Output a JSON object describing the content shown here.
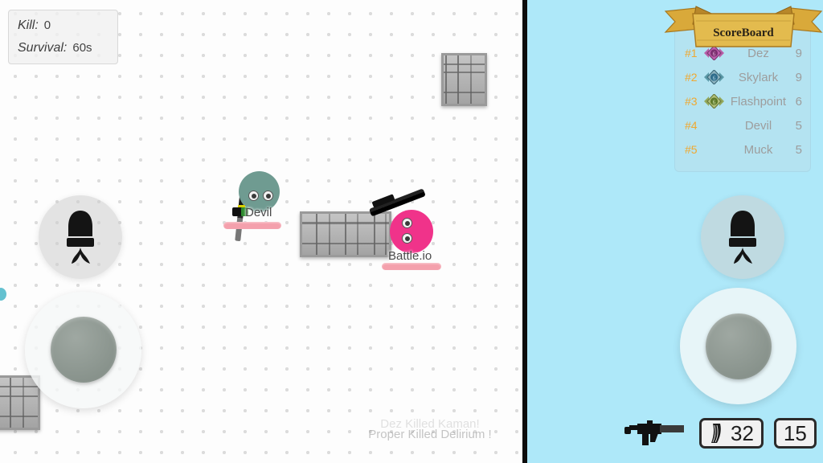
{
  "hud": {
    "stats": {
      "kill_label": "Kill:",
      "kill_value": "0",
      "survival_label": "Survival:",
      "survival_value": "60s"
    },
    "ammo": {
      "weapon_icon": "submachine-gun-icon",
      "magazine_icon": "magazine-icon",
      "clip": "32",
      "reserve": "15"
    },
    "controls": {
      "shoot_icon": "rocket-bullet-icon",
      "joystick": "movement-joystick"
    }
  },
  "scoreboard": {
    "title": "ScoreBoard",
    "banner_icon": "gold-ribbon-banner",
    "columns": [
      "rank",
      "medal",
      "name",
      "score"
    ],
    "rows": [
      {
        "rank": "#1",
        "name": "Dez",
        "score": "9",
        "medal": "medal-pink"
      },
      {
        "rank": "#2",
        "name": "Skylark",
        "score": "9",
        "medal": "medal-blue"
      },
      {
        "rank": "#3",
        "name": "Flashpoint",
        "score": "6",
        "medal": "medal-green"
      },
      {
        "rank": "#4",
        "name": "Devil",
        "score": "5",
        "medal": ""
      },
      {
        "rank": "#5",
        "name": "Muck",
        "score": "5",
        "medal": ""
      }
    ]
  },
  "killfeed": {
    "line1": "Dez Killed Kaman!",
    "line2": "Proper Killed Delirium !"
  },
  "entities": [
    {
      "name": "Devil",
      "color": "#6f9b91",
      "weapon": "knife"
    },
    {
      "name": "Battle.io",
      "color": "#f0338a",
      "weapon": "rifle"
    }
  ],
  "colors": {
    "world_background": "#fdfdfd",
    "world_dots": "#dcdcdc",
    "panel_background": "#aee8f9",
    "divider": "#0d0d0d",
    "health_bar": "#f4a0ac",
    "rank_accent": "#f0a830",
    "banner_gold": "#e0b23c"
  }
}
